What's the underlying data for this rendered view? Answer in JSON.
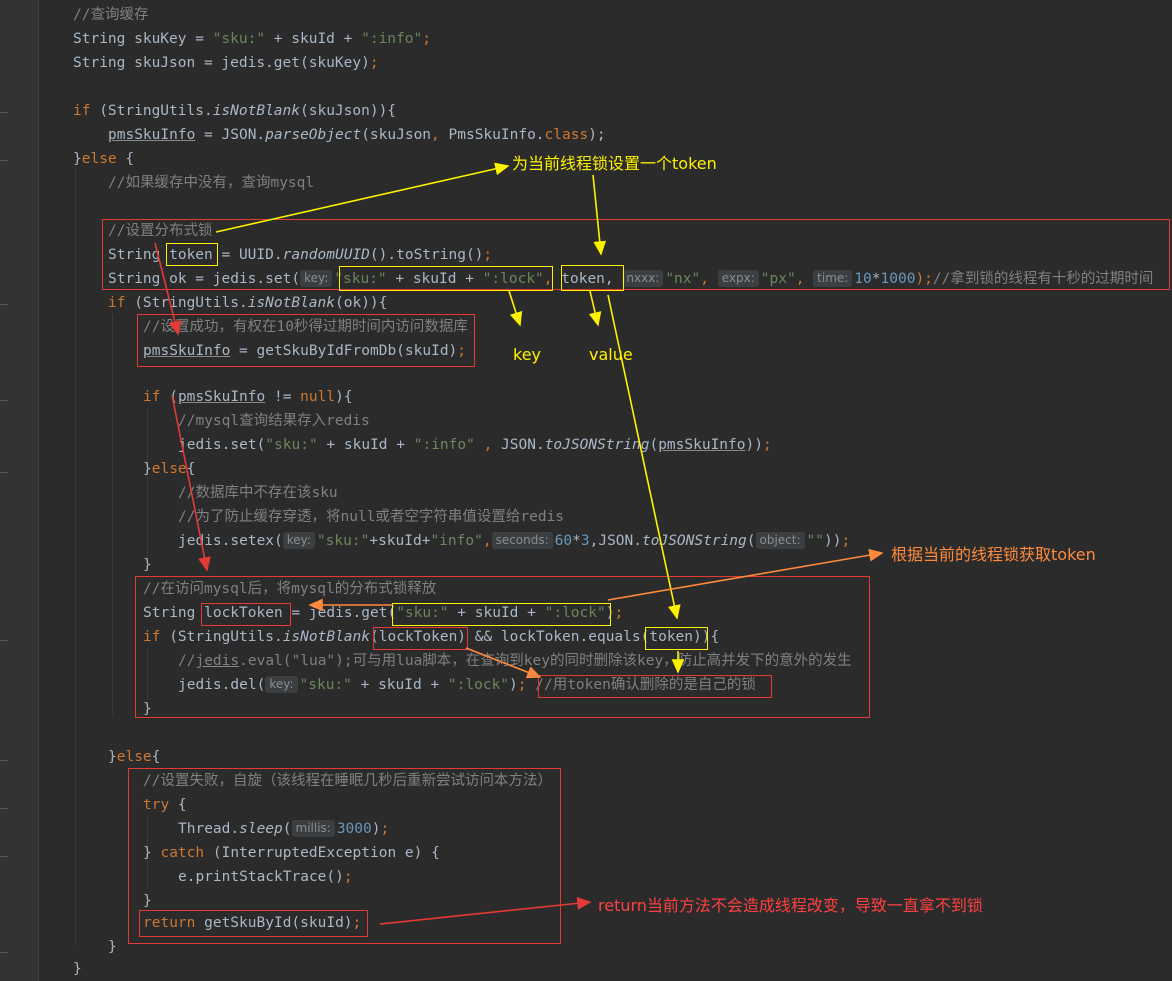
{
  "code": {
    "l1_comment": "//查询缓存",
    "l2_a": "String skuKey = ",
    "l2_b": "\"sku:\"",
    "l2_c": " + skuId + ",
    "l2_d": "\":info\"",
    "l2_e": ";",
    "l3_a": "String skuJson = jedis.get(skuKey)",
    "l3_b": ";",
    "l5_a": "if",
    "l5_b": " (StringUtils.",
    "l5_c": "isNotBlank",
    "l5_d": "(skuJson)){",
    "l6_a": "pmsSkuInfo",
    "l6_b": " = JSON.",
    "l6_c": "parseObject",
    "l6_d": "(skuJson",
    "l6_e": ", ",
    "l6_f": "PmsSkuInfo.",
    "l6_g": "class",
    "l6_h": ");",
    "l7_a": "}",
    "l7_b": "else",
    "l7_c": " {",
    "l8_comment": "//如果缓存中没有，查询mysql",
    "l10_comment": "//设置分布式锁",
    "l11_a": "String ",
    "l11_b": "token",
    "l11_c": " = UUID.",
    "l11_d": "randomUUID",
    "l11_e": "().toString()",
    "l11_f": ";",
    "l12_a": "String ok = jedis.set(",
    "l12_hint_key": "key:",
    "l12_b": "\"sku:\"",
    "l12_c": " + skuId + ",
    "l12_d": "\":lock\"",
    "l12_e": ", ",
    "l12_f": "token,",
    "l12_hint_nxxx": "nxxx:",
    "l12_g": "\"nx\"",
    "l12_h": ", ",
    "l12_hint_expx": "expx:",
    "l12_i": "\"px\"",
    "l12_j": ", ",
    "l12_hint_time": "time:",
    "l12_k": "10",
    "l12_l": "*",
    "l12_m": "1000",
    "l12_n": ");",
    "l12_comment": "//拿到锁的线程有十秒的过期时间",
    "l13_a": "if",
    "l13_b": " (StringUtils.",
    "l13_c": "isNotBlank",
    "l13_d": "(ok)){",
    "l14_comment": "//设置成功，有权在10秒得过期时间内访问数据库",
    "l15_a": "pmsSkuInfo",
    "l15_b": " = getSkuByIdFromDb(skuId)",
    "l15_c": ";",
    "l17_a": "if",
    "l17_b": " (",
    "l17_c": "pmsSkuInfo",
    "l17_d": " != ",
    "l17_e": "null",
    "l17_f": "){",
    "l18_comment": "//mysql查询结果存入redis",
    "l19_a": "jedis.set(",
    "l19_b": "\"sku:\"",
    "l19_c": " + skuId + ",
    "l19_d": "\":info\"",
    "l19_e": " , ",
    "l19_f": "JSON.",
    "l19_g": "toJSONString",
    "l19_h": "(",
    "l19_i": "pmsSkuInfo",
    "l19_j": "))",
    "l19_k": ";",
    "l20_a": "}",
    "l20_b": "else",
    "l20_c": "{",
    "l21_comment": "//数据库中不存在该sku",
    "l22_comment": "//为了防止缓存穿透，将null或者空字符串值设置给redis",
    "l23_a": "jedis.setex(",
    "l23_hint_key": "key:",
    "l23_b": "\"sku:\"",
    "l23_c": "+skuId+",
    "l23_d": "\"info\"",
    "l23_e": ",",
    "l23_hint_seconds": "seconds:",
    "l23_f": "60",
    "l23_g": "*",
    "l23_h": "3",
    "l23_i": ",JSON.",
    "l23_j": "toJSONString",
    "l23_k": "(",
    "l23_hint_object": "object:",
    "l23_l": "\"\"",
    "l23_m": "))",
    "l23_n": ";",
    "l24": "}",
    "l25_comment": "//在访问mysql后，将mysql的分布式锁释放",
    "l26_a": "String ",
    "l26_b": "lockToken",
    "l26_c": " = jedis.get(",
    "l26_d": "\"sku:\"",
    "l26_e": " + skuId + ",
    "l26_f": "\":lock\"",
    "l26_g": ")",
    "l26_h": ";",
    "l27_a": "if",
    "l27_b": " (StringUtils.",
    "l27_c": "isNotBlank",
    "l27_d": "(lockToken)",
    "l27_e": " && lockToken.equals(",
    "l27_f": "token",
    "l27_g": ")){",
    "l28_a": "//",
    "l28_b": "jedis",
    "l28_c": ".eval(\"lua\");可与用lua脚本，在查询到key的同时删除该key，防止高并发下的意外的发生",
    "l29_a": "jedis.del(",
    "l29_hint_key": "key:",
    "l29_b": "\"sku:\"",
    "l29_c": " + skuId + ",
    "l29_d": "\":lock\"",
    "l29_e": ")",
    "l29_f": ";",
    "l29_comment": "//用token确认删除的是自己的锁",
    "l30": "}",
    "l32_a": "}",
    "l32_b": "else",
    "l32_c": "{",
    "l33_comment": "//设置失败，自旋（该线程在睡眠几秒后重新尝试访问本方法）",
    "l34_a": "try",
    "l34_b": " {",
    "l35_a": "Thread.",
    "l35_b": "sleep",
    "l35_c": "(",
    "l35_hint_millis": "millis:",
    "l35_d": "3000",
    "l35_e": ")",
    "l35_f": ";",
    "l36_a": "} ",
    "l36_b": "catch",
    "l36_c": " (InterruptedException e) {",
    "l37_a": "e.printStackTrace()",
    "l37_b": ";",
    "l38": "}",
    "l39_a": "return",
    "l39_b": " getSkuById(skuId)",
    "l39_c": ";",
    "l40": "}",
    "l41": "}"
  },
  "annotations": {
    "set_token": "为当前线程锁设置一个token",
    "key": "key",
    "value": "value",
    "get_token": "根据当前的线程锁获取token",
    "return_note": "return当前方法不会造成线程改变，导致一直拿不到锁"
  },
  "colors": {
    "background": "#2b2b2b",
    "keyword": "#cc7832",
    "string": "#6a8759",
    "comment": "#808080",
    "number": "#6897bb",
    "field": "#9876aa",
    "annotation_yellow": "#fff200",
    "annotation_orange": "#ff8a3d",
    "annotation_red": "#ff4040"
  }
}
